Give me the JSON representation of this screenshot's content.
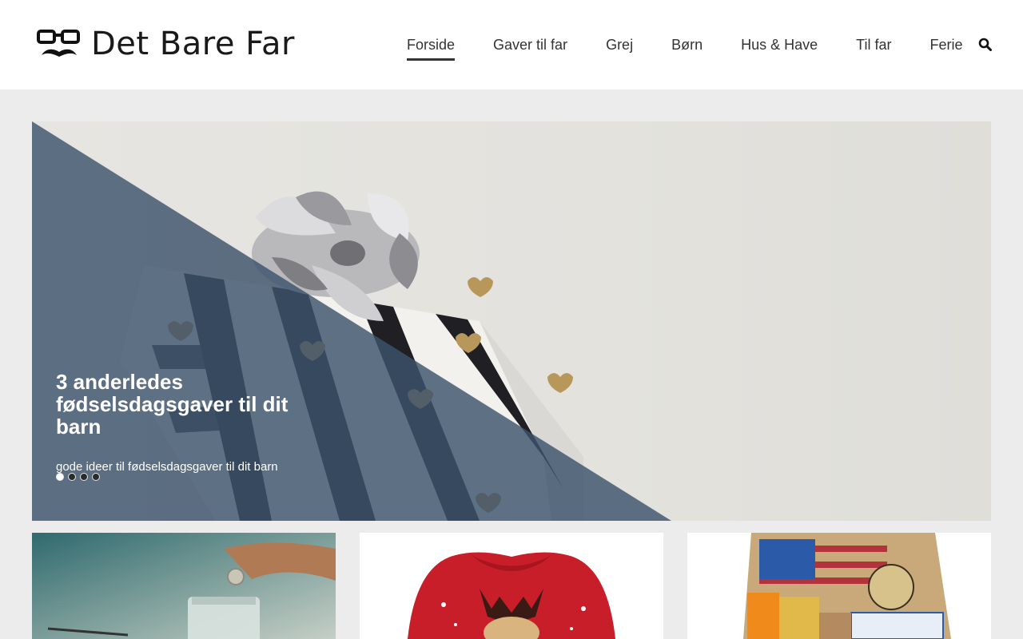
{
  "site": {
    "name": "Det Bare Far",
    "logo_icon": "glasses-mustache-icon"
  },
  "nav": {
    "items": [
      {
        "label": "Forside",
        "active": true
      },
      {
        "label": "Gaver til far",
        "active": false
      },
      {
        "label": "Grej",
        "active": false
      },
      {
        "label": "Børn",
        "active": false
      },
      {
        "label": "Hus & Have",
        "active": false
      },
      {
        "label": "Til far",
        "active": false
      },
      {
        "label": "Ferie",
        "active": false
      }
    ],
    "search_icon": "search-icon"
  },
  "slider": {
    "title": "3 anderledes fødselsdagsgaver til dit barn",
    "subtitle": "gode ideer til fødselsdagsgaver til dit barn",
    "dots": 4,
    "active_dot": 1,
    "overlay_color": "#3d536b"
  },
  "cards": [
    {
      "name": "coins-jar-card"
    },
    {
      "name": "christmas-sweater-card"
    },
    {
      "name": "candy-box-card"
    }
  ]
}
